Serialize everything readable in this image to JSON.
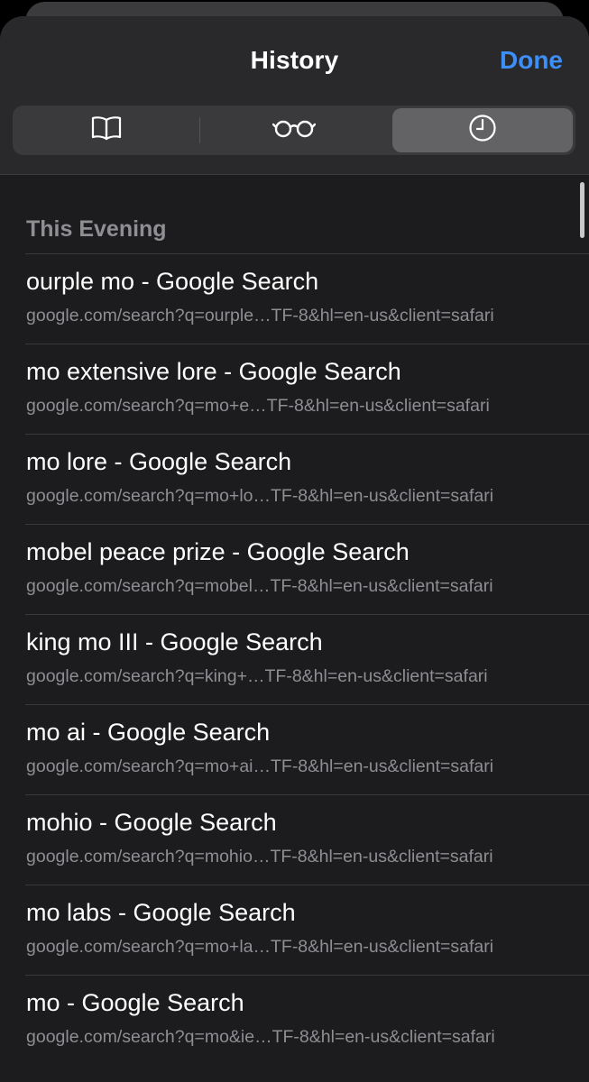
{
  "header": {
    "title": "History",
    "done_label": "Done"
  },
  "tabs": [
    {
      "icon": "book-icon",
      "name": "Bookmarks",
      "selected": false
    },
    {
      "icon": "glasses-icon",
      "name": "Reading List",
      "selected": false
    },
    {
      "icon": "clock-icon",
      "name": "History",
      "selected": true
    }
  ],
  "section": {
    "title": "This Evening"
  },
  "items": [
    {
      "title": "ourple mo - Google Search",
      "url": "google.com/search?q=ourple…TF-8&hl=en-us&client=safari"
    },
    {
      "title": "mo extensive lore - Google Search",
      "url": "google.com/search?q=mo+e…TF-8&hl=en-us&client=safari"
    },
    {
      "title": "mo lore - Google Search",
      "url": "google.com/search?q=mo+lo…TF-8&hl=en-us&client=safari"
    },
    {
      "title": "mobel peace prize - Google Search",
      "url": "google.com/search?q=mobel…TF-8&hl=en-us&client=safari"
    },
    {
      "title": "king mo III - Google Search",
      "url": "google.com/search?q=king+…TF-8&hl=en-us&client=safari"
    },
    {
      "title": "mo ai - Google Search",
      "url": "google.com/search?q=mo+ai…TF-8&hl=en-us&client=safari"
    },
    {
      "title": "mohio - Google Search",
      "url": "google.com/search?q=mohio…TF-8&hl=en-us&client=safari"
    },
    {
      "title": "mo labs - Google Search",
      "url": "google.com/search?q=mo+la…TF-8&hl=en-us&client=safari"
    },
    {
      "title": "mo - Google Search",
      "url": "google.com/search?q=mo&ie…TF-8&hl=en-us&client=safari"
    }
  ],
  "colors": {
    "background": "#1c1c1e",
    "header": "#29292b",
    "accent": "#3d8ef7",
    "secondary_text": "#8e8e93",
    "selected_segment": "#636366"
  }
}
